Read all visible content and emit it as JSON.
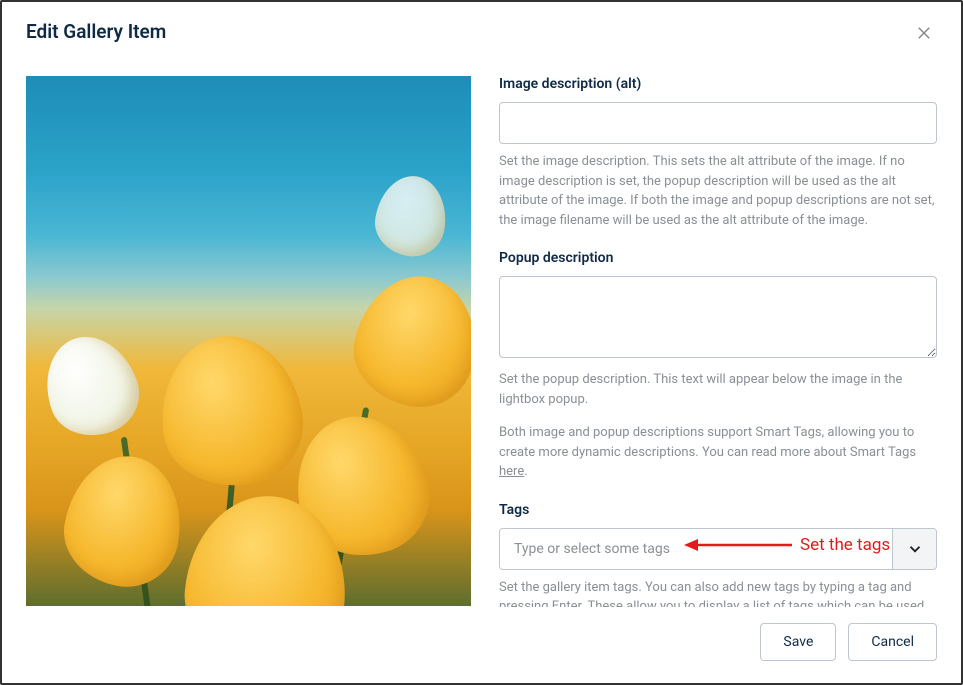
{
  "modal": {
    "title": "Edit Gallery Item"
  },
  "fields": {
    "alt": {
      "label": "Image description (alt)",
      "value": "",
      "help": "Set the image description. This sets the alt attribute of the image. If no image description is set, the popup description will be used as the alt attribute of the image. If both the image and popup descriptions are not set, the image filename will be used as the alt attribute of the image."
    },
    "popup": {
      "label": "Popup description",
      "value": "",
      "help": "Set the popup description. This text will appear below the image in the lightbox popup."
    },
    "smart_tags_note": {
      "text_before": "Both image and popup descriptions support Smart Tags, allowing you to create more dynamic descriptions. You can read more about Smart Tags ",
      "link_text": "here",
      "text_after": "."
    },
    "tags": {
      "label": "Tags",
      "placeholder": "Type or select some tags",
      "help": "Set the gallery item tags. You can also add new tags by typing a tag and pressing Enter. These allow you to display a list of tags which can be used to filter the gallery items on your site."
    }
  },
  "annotation": {
    "text": "Set the tags"
  },
  "buttons": {
    "save": "Save",
    "cancel": "Cancel"
  }
}
